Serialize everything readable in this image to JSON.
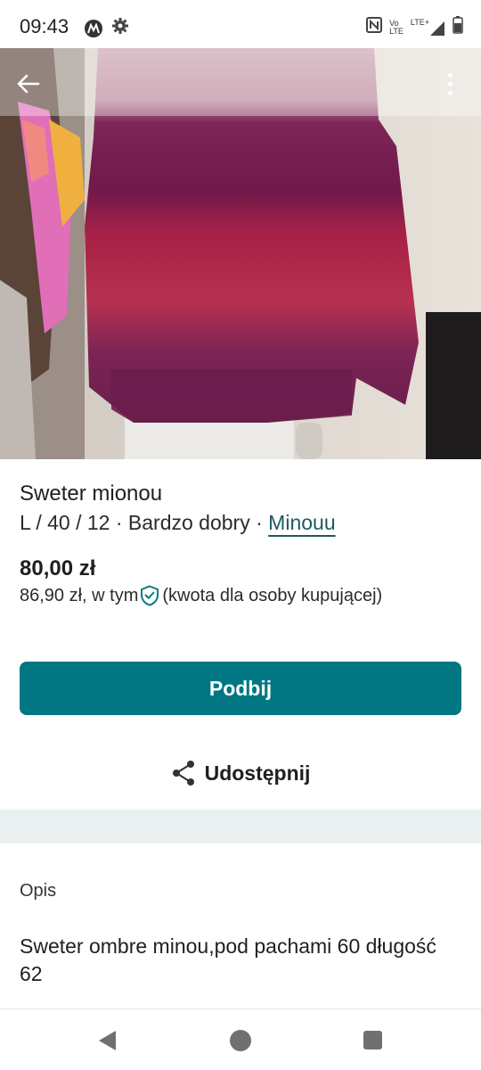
{
  "status_bar": {
    "time": "09:43",
    "volte_top": "Vo",
    "volte_bottom": "LTE",
    "network": "LTE+",
    "icons": [
      "motorola-icon",
      "settings-icon",
      "nfc-icon",
      "volte-icon",
      "signal-icon",
      "battery-icon"
    ]
  },
  "photo": {
    "icons": [
      "back-arrow-icon",
      "more-vertical-icon"
    ],
    "colors": {
      "sweater_top": "#c79aa8",
      "sweater_mid": "#7b2357",
      "sweater_red": "#b0284a",
      "sweater_bottom": "#6e1f4f"
    }
  },
  "item": {
    "title": "Sweter mionou",
    "size": "L / 40 / 12",
    "sep1": " · ",
    "condition": "Bardzo dobry",
    "sep2": " · ",
    "brand": "Minouu",
    "price": "80,00 zł",
    "buyer_price": "86,90 zł, w tym",
    "buyer_note": "(kwota dla osoby kupującej)"
  },
  "actions": {
    "bump_label": "Podbij",
    "share_label": "Udostępnij"
  },
  "description": {
    "heading": "Opis",
    "text": "Sweter ombre minou,pod pachami 60 długość 62"
  },
  "colors": {
    "accent": "#007782",
    "band": "#eaf0ef",
    "brand_link": "#1d5a60"
  }
}
